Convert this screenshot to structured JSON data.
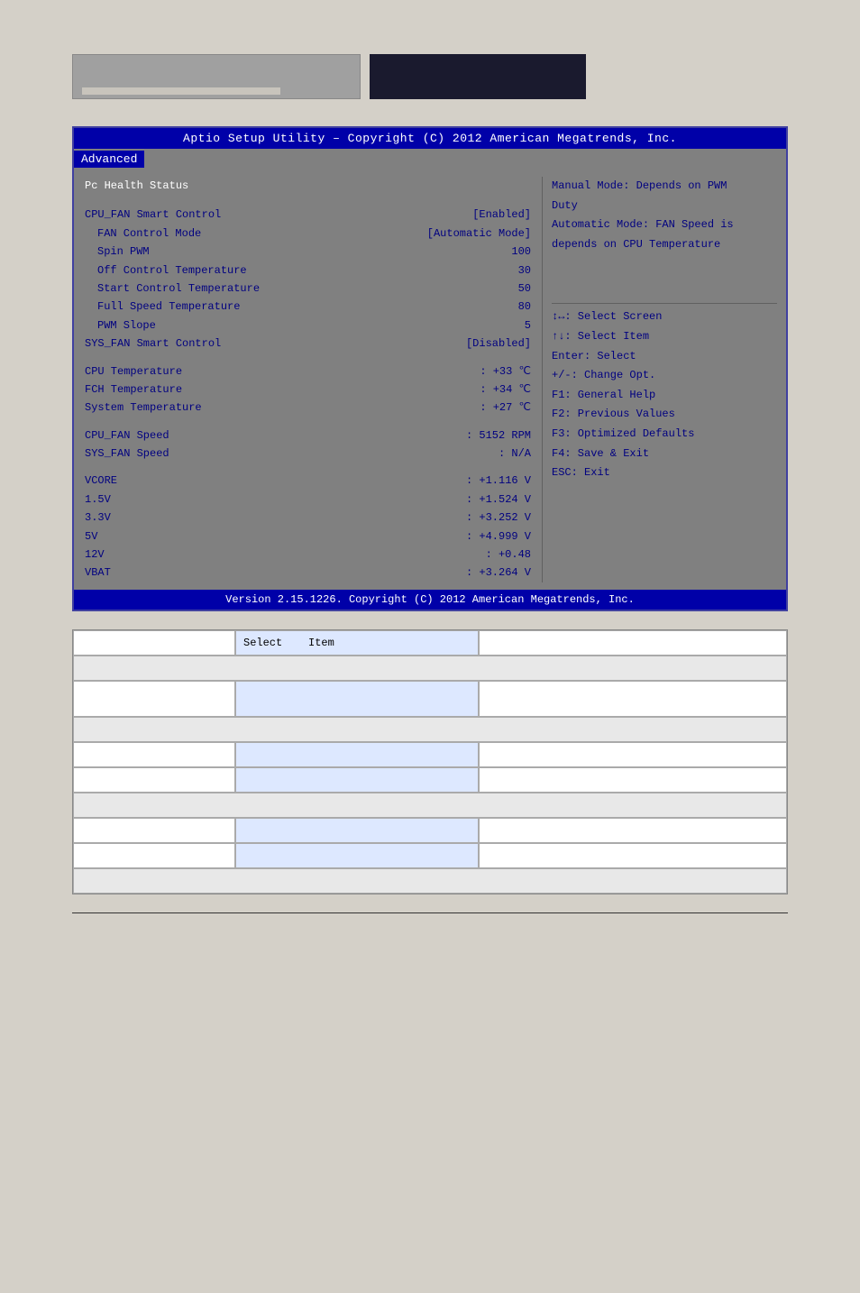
{
  "header": {
    "title_right": ""
  },
  "bios": {
    "title": "Aptio Setup Utility – Copyright (C) 2012 American Megatrends, Inc.",
    "menu_items": [
      "Advanced"
    ],
    "active_menu": "Advanced",
    "section_title": "Pc Health Status",
    "items": [
      {
        "key": "CPU_FAN Smart Control",
        "val": "[Enabled]",
        "sub": false
      },
      {
        "key": "FAN Control Mode",
        "val": "[Automatic Mode]",
        "sub": true
      },
      {
        "key": "Spin PWM",
        "val": "100",
        "sub": true
      },
      {
        "key": "Off Control Temperature",
        "val": "30",
        "sub": true
      },
      {
        "key": "Start Control Temperature",
        "val": "50",
        "sub": true
      },
      {
        "key": "Full Speed Temperature",
        "val": "80",
        "sub": true
      },
      {
        "key": "PWM Slope",
        "val": "5",
        "sub": true
      },
      {
        "key": "SYS_FAN Smart Control",
        "val": "[Disabled]",
        "sub": false
      }
    ],
    "temps": [
      {
        "key": "CPU Temperature",
        "val": ": +33 ℃"
      },
      {
        "key": "FCH Temperature",
        "val": ": +34 ℃"
      },
      {
        "key": "System Temperature",
        "val": ": +27 ℃"
      }
    ],
    "fans": [
      {
        "key": "CPU_FAN Speed",
        "val": ": 5152 RPM"
      },
      {
        "key": "SYS_FAN Speed",
        "val": ": N/A"
      }
    ],
    "voltages": [
      {
        "key": "VCORE",
        "val": ": +1.116 V"
      },
      {
        "key": "1.5V",
        "val": ": +1.524 V"
      },
      {
        "key": "3.3V",
        "val": ": +3.252 V"
      },
      {
        "key": "5V",
        "val": ": +4.999 V"
      },
      {
        "key": "12V",
        "val": ": +0.48"
      },
      {
        "key": "VBAT",
        "val": ": +3.264 V"
      }
    ],
    "right_info": [
      "Manual Mode: Depends on PWM",
      "Duty",
      "Automatic Mode: FAN Speed is",
      "depends on CPU Temperature"
    ],
    "hints": [
      "↕↔: Select Screen",
      "↑↓: Select Item",
      "Enter: Select",
      "+/-: Change Opt.",
      "F1: General Help",
      "F2: Previous Values",
      "F3: Optimized Defaults",
      "F4: Save & Exit",
      "ESC: Exit"
    ],
    "footer": "Version 2.15.1226. Copyright (C) 2012 American Megatrends, Inc."
  },
  "table": {
    "rows": [
      {
        "col1": "",
        "col2": "",
        "col3": "",
        "type": "normal"
      },
      {
        "col1": "",
        "col2": "",
        "col3": "",
        "type": "highlight"
      },
      {
        "col1": "",
        "col2": "",
        "col3": "",
        "type": "span3",
        "text": ""
      },
      {
        "col1": "",
        "col2": "",
        "col3": "",
        "type": "normal"
      },
      {
        "col1": "",
        "col2": "",
        "col3": "",
        "type": "highlight"
      },
      {
        "col1": "",
        "col2": "",
        "col3": "",
        "type": "span3",
        "text": ""
      },
      {
        "col1": "",
        "col2": "",
        "col3": "",
        "type": "normal"
      },
      {
        "col1": "",
        "col2": "",
        "col3": "",
        "type": "highlight"
      },
      {
        "col1": "",
        "col2": "",
        "col3": "",
        "type": "normal"
      },
      {
        "col1": "",
        "col2": "",
        "col3": "",
        "type": "span3",
        "text": ""
      },
      {
        "col1": "",
        "col2": "",
        "col3": "",
        "type": "normal"
      },
      {
        "col1": "",
        "col2": "",
        "col3": "",
        "type": "highlight"
      },
      {
        "col1": "",
        "col2": "",
        "col3": "",
        "type": "normal"
      },
      {
        "col1": "",
        "col2": "",
        "col3": "",
        "type": "span3",
        "text": ""
      }
    ],
    "select_label": "Select",
    "item_label": "Item"
  }
}
